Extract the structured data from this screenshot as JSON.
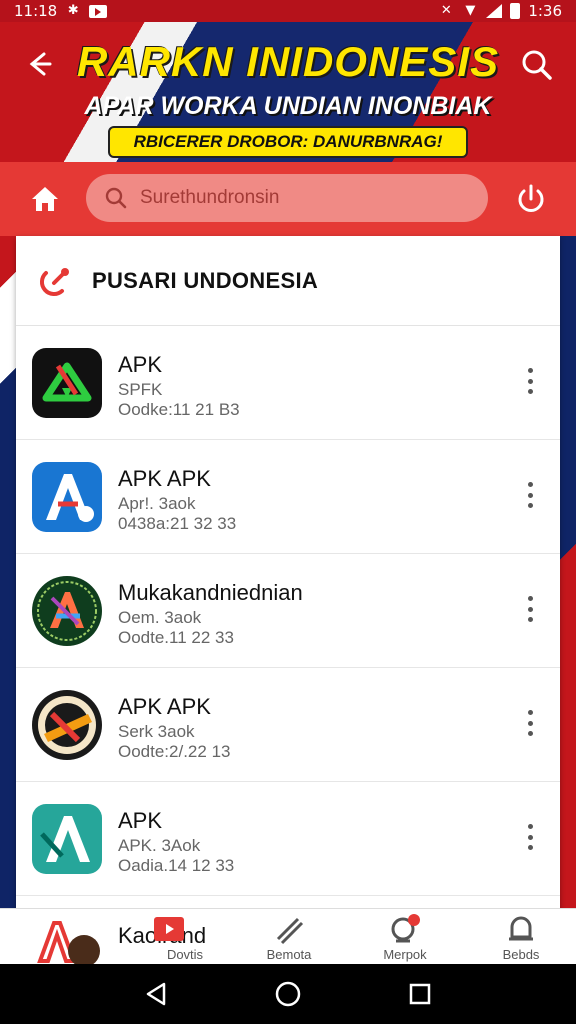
{
  "status_bar": {
    "time_left": "11:18",
    "time_right": "1:36"
  },
  "banner": {
    "title": "RARKN INIDONESIS",
    "subtitle": "APAR WORKA UNDIAN INONBIAK",
    "pill": "RBICERER DROBOR: DANURBNRAG!"
  },
  "search": {
    "placeholder": "Surethundronsin"
  },
  "section": {
    "title": "PUSARI UNDONESIA"
  },
  "apps": [
    {
      "name": "APK",
      "line1": "SPFK",
      "line2": "Oodke:11 21 B3",
      "icon": "download-arrow-icon",
      "color": "#1e8e3e"
    },
    {
      "name": "APK APK",
      "line1": "Apr!. 3aok",
      "line2": "0438a:21 32 33",
      "icon": "letter-a-icon",
      "color": "#1976d2"
    },
    {
      "name": "Mukakandniednian",
      "line1": "Oem. 3aok",
      "line2": "Oodte.11 22 33",
      "icon": "colorful-a-badge-icon",
      "color": "#1b5e20"
    },
    {
      "name": "APK APK",
      "line1": "Serk 3aok",
      "line2": "Oodte:2/.22 13",
      "icon": "wrench-badge-icon",
      "color": "#222222"
    },
    {
      "name": "APK",
      "line1": "APK. 3Aok",
      "line2": "Oadia.14 12 33",
      "icon": "teal-a-icon",
      "color": "#26a69a"
    }
  ],
  "peek_row": {
    "name": "Kaolrand"
  },
  "bottom_nav": [
    {
      "label": "Dovtis",
      "icon": "video-icon"
    },
    {
      "label": "Bemota",
      "icon": "tools-icon"
    },
    {
      "label": "Merpok",
      "icon": "support-icon"
    },
    {
      "label": "Bebds",
      "icon": "bell-icon"
    }
  ],
  "colors": {
    "accent": "#e53935",
    "banner_yellow": "#ffe600",
    "navy": "#15286e"
  }
}
